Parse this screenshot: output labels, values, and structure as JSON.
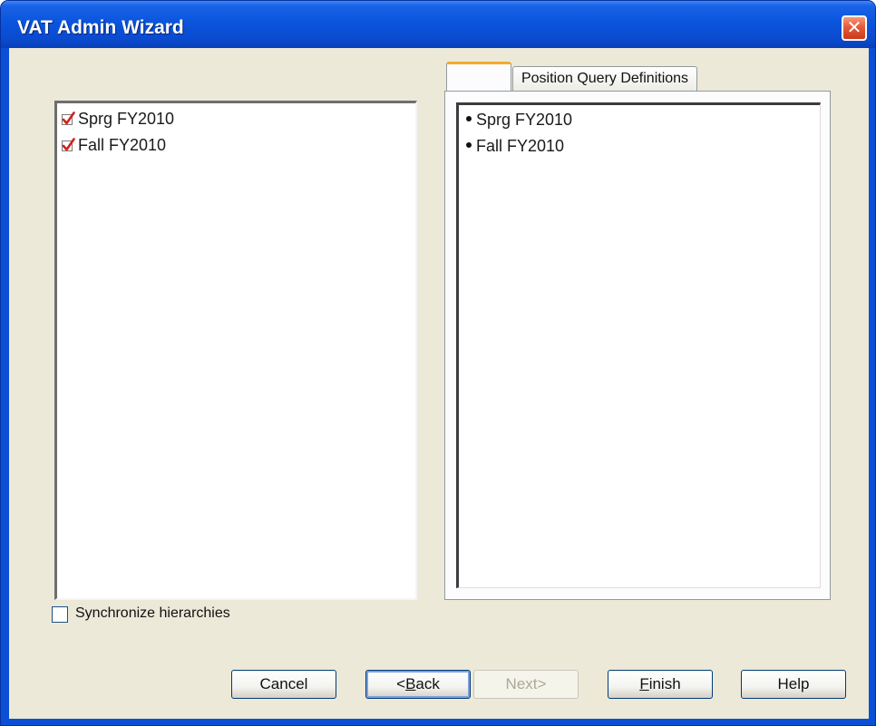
{
  "window": {
    "title": "VAT Admin Wizard",
    "close_glyph": "✕"
  },
  "left_list": {
    "items": [
      {
        "label": "Sprg FY2010",
        "icon": "check-icon"
      },
      {
        "label": "Fall FY2010",
        "icon": "check-icon"
      }
    ]
  },
  "tabs": [
    {
      "label": ""
    },
    {
      "label": "Position Query Definitions"
    }
  ],
  "right_list": {
    "items": [
      {
        "label": "Sprg FY2010",
        "icon": "bullet-icon"
      },
      {
        "label": "Fall FY2010",
        "icon": "bullet-icon"
      }
    ]
  },
  "sync_checkbox": {
    "label": "Synchronize hierarchies",
    "checked": false
  },
  "buttons": {
    "cancel": "Cancel",
    "back_prefix": "<",
    "back_mnemonic": "B",
    "back_rest": "ack",
    "next": "Next>",
    "finish_mnemonic": "F",
    "finish_rest": "inish",
    "help": "Help"
  },
  "colors": {
    "title_bar": "#0a55dc",
    "dialog_bg": "#ece9d8",
    "check_red": "#d4201a",
    "active_tab_accent": "#f4a92c"
  }
}
